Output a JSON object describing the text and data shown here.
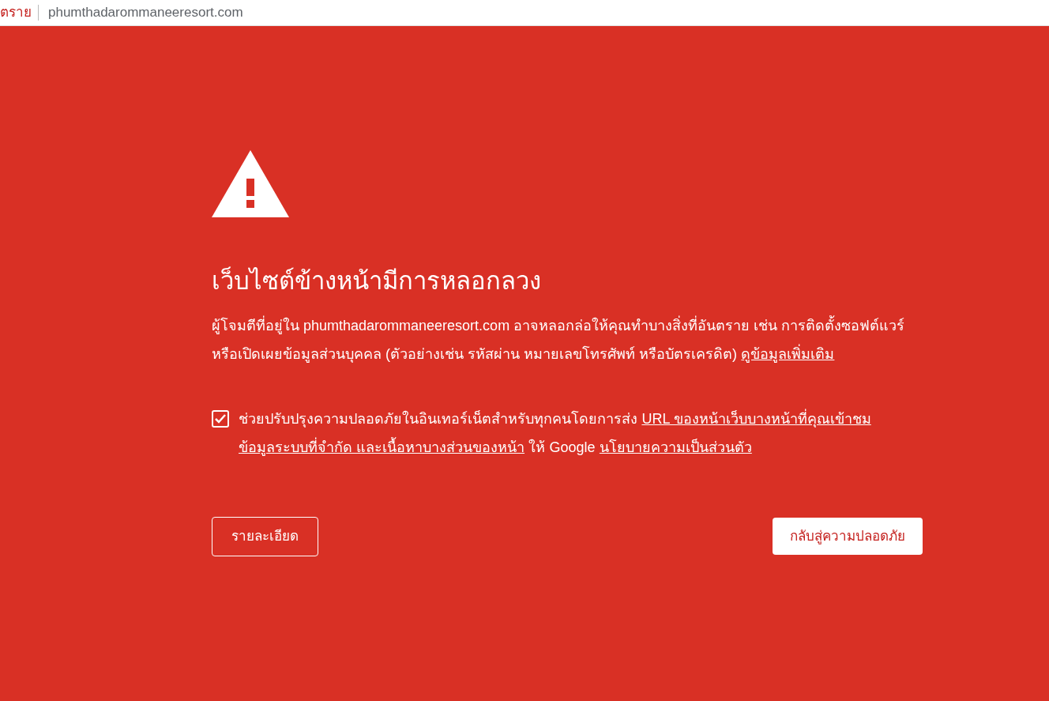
{
  "address_bar": {
    "security_label": "ตราย",
    "url": "phumthadarommaneeresort.com"
  },
  "warning": {
    "title": "เว็บไซต์ข้างหน้ามีการหลอกลวง",
    "description": [
      {
        "text": "ผู้โจมตีที่อยู่ใน phumthadarommaneeresort.com อาจหลอกล่อให้คุณทำบางสิ่งที่อันตราย เช่น การติดตั้งซอฟต์แวร์หรือเปิดเผยข้อมูลส่วนบุคคล (ตัวอย่างเช่น รหัสผ่าน หมายเลขโทรศัพท์ หรือบัตรเครดิต)",
        "kind": "text"
      },
      {
        "text": "ดูข้อมูลเพิ่มเติม",
        "kind": "link"
      }
    ],
    "report_option": {
      "checked": true,
      "label": [
        {
          "text": "ช่วยปรับปรุงความปลอดภัยในอินเทอร์เน็ตสำหรับทุกคนโดยการส่ง",
          "kind": "text"
        },
        {
          "text": "URL ของหน้าเว็บบางหน้าที่คุณเข้าชม",
          "kind": "link"
        },
        {
          "text": "ข้อมูลระบบที่จำกัด และเนื้อหาบางส่วนของหน้า",
          "kind": "link"
        },
        {
          "text": "ให้ Google",
          "kind": "text"
        },
        {
          "text": "นโยบายความเป็นส่วนตัว",
          "kind": "link"
        }
      ]
    },
    "buttons": [
      {
        "label": "รายละเอียด",
        "kind": "outline"
      },
      {
        "label": "กลับสู่ความปลอดภัย",
        "kind": "primary"
      }
    ]
  }
}
